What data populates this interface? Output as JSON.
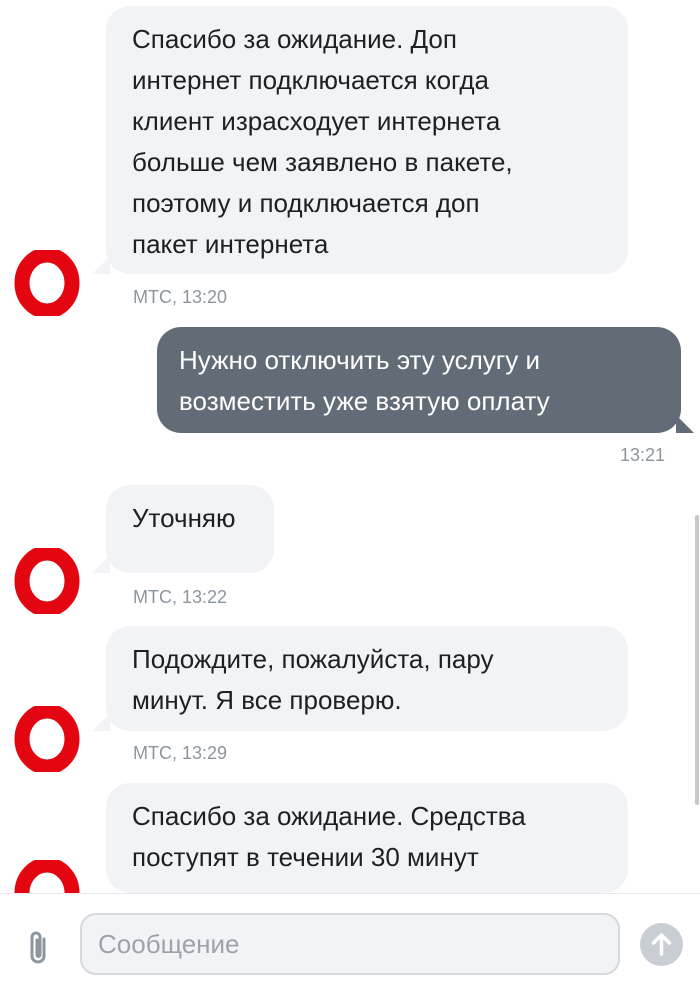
{
  "chat": {
    "messages": [
      {
        "text": "Спасибо за ожидание. Доп\nинтернет подключается когда\nклиент израсходует интернета\nбольше чем заявлено в пакете,\nпоэтому и подключается доп\nпакет интернета",
        "meta": "МТС, 13:20"
      },
      {
        "text": "Нужно отключить эту услугу и\nвозместить уже взятую оплату",
        "meta": "13:21"
      },
      {
        "text": "Уточняю",
        "meta": "МТС, 13:22"
      },
      {
        "text": "Подождите, пожалуйста, пару\nминут. Я все проверю.",
        "meta": "МТС, 13:29"
      },
      {
        "text": "Спасибо за ожидание. Средства\nпоступят в течении 30 минут",
        "meta": ""
      }
    ]
  },
  "composer": {
    "placeholder": "Сообщение"
  },
  "icons": {
    "avatar": "mts-logo-icon",
    "attach": "paperclip-icon",
    "send": "arrow-up-icon"
  },
  "colors": {
    "brand": "#e30611",
    "incoming_bubble": "#f2f3f7",
    "outgoing_bubble": "#626c77",
    "meta_text": "#8d969f"
  }
}
